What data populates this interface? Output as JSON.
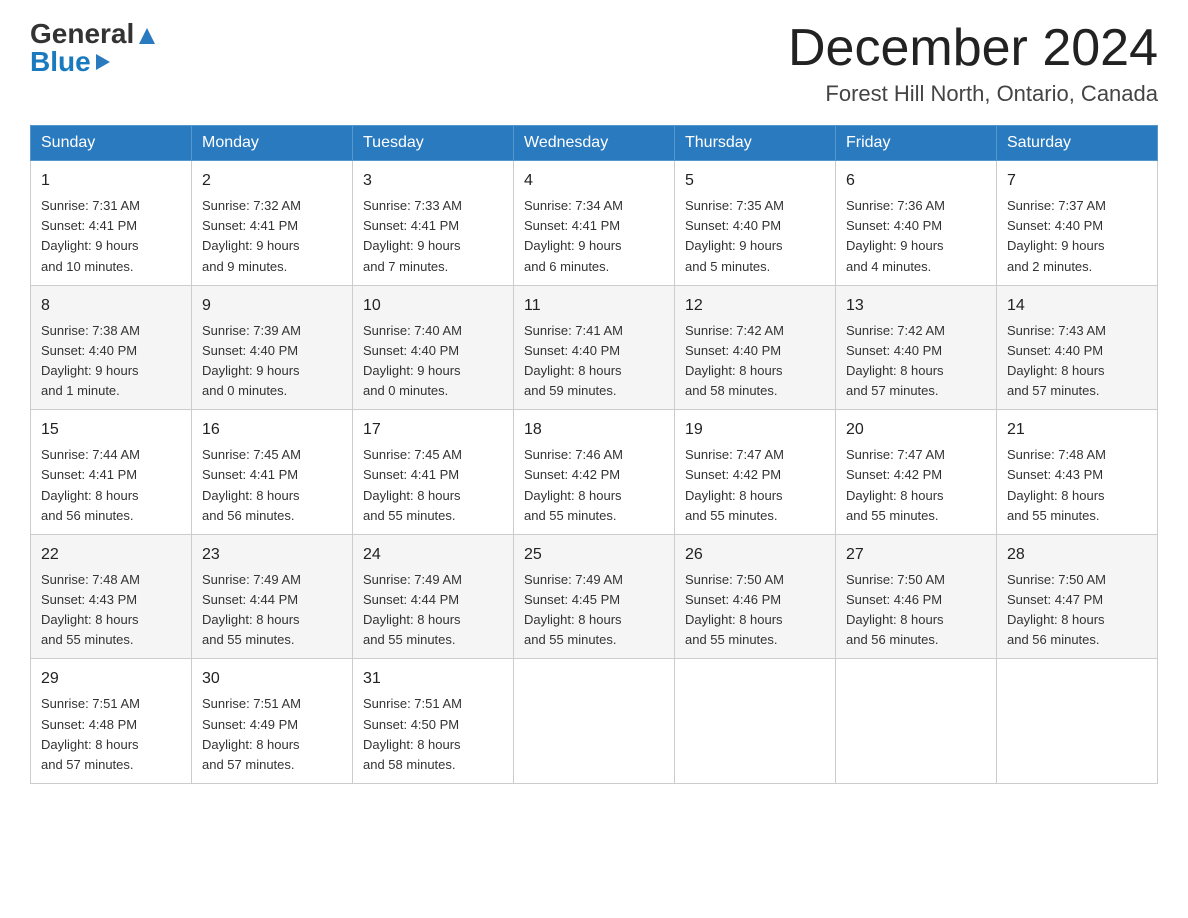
{
  "header": {
    "logo_general": "General",
    "logo_blue": "Blue",
    "month_title": "December 2024",
    "location": "Forest Hill North, Ontario, Canada"
  },
  "weekdays": [
    "Sunday",
    "Monday",
    "Tuesday",
    "Wednesday",
    "Thursday",
    "Friday",
    "Saturday"
  ],
  "weeks": [
    [
      {
        "day": "1",
        "sunrise": "7:31 AM",
        "sunset": "4:41 PM",
        "daylight": "9 hours and 10 minutes."
      },
      {
        "day": "2",
        "sunrise": "7:32 AM",
        "sunset": "4:41 PM",
        "daylight": "9 hours and 9 minutes."
      },
      {
        "day": "3",
        "sunrise": "7:33 AM",
        "sunset": "4:41 PM",
        "daylight": "9 hours and 7 minutes."
      },
      {
        "day": "4",
        "sunrise": "7:34 AM",
        "sunset": "4:41 PM",
        "daylight": "9 hours and 6 minutes."
      },
      {
        "day": "5",
        "sunrise": "7:35 AM",
        "sunset": "4:40 PM",
        "daylight": "9 hours and 5 minutes."
      },
      {
        "day": "6",
        "sunrise": "7:36 AM",
        "sunset": "4:40 PM",
        "daylight": "9 hours and 4 minutes."
      },
      {
        "day": "7",
        "sunrise": "7:37 AM",
        "sunset": "4:40 PM",
        "daylight": "9 hours and 2 minutes."
      }
    ],
    [
      {
        "day": "8",
        "sunrise": "7:38 AM",
        "sunset": "4:40 PM",
        "daylight": "9 hours and 1 minute."
      },
      {
        "day": "9",
        "sunrise": "7:39 AM",
        "sunset": "4:40 PM",
        "daylight": "9 hours and 0 minutes."
      },
      {
        "day": "10",
        "sunrise": "7:40 AM",
        "sunset": "4:40 PM",
        "daylight": "9 hours and 0 minutes."
      },
      {
        "day": "11",
        "sunrise": "7:41 AM",
        "sunset": "4:40 PM",
        "daylight": "8 hours and 59 minutes."
      },
      {
        "day": "12",
        "sunrise": "7:42 AM",
        "sunset": "4:40 PM",
        "daylight": "8 hours and 58 minutes."
      },
      {
        "day": "13",
        "sunrise": "7:42 AM",
        "sunset": "4:40 PM",
        "daylight": "8 hours and 57 minutes."
      },
      {
        "day": "14",
        "sunrise": "7:43 AM",
        "sunset": "4:40 PM",
        "daylight": "8 hours and 57 minutes."
      }
    ],
    [
      {
        "day": "15",
        "sunrise": "7:44 AM",
        "sunset": "4:41 PM",
        "daylight": "8 hours and 56 minutes."
      },
      {
        "day": "16",
        "sunrise": "7:45 AM",
        "sunset": "4:41 PM",
        "daylight": "8 hours and 56 minutes."
      },
      {
        "day": "17",
        "sunrise": "7:45 AM",
        "sunset": "4:41 PM",
        "daylight": "8 hours and 55 minutes."
      },
      {
        "day": "18",
        "sunrise": "7:46 AM",
        "sunset": "4:42 PM",
        "daylight": "8 hours and 55 minutes."
      },
      {
        "day": "19",
        "sunrise": "7:47 AM",
        "sunset": "4:42 PM",
        "daylight": "8 hours and 55 minutes."
      },
      {
        "day": "20",
        "sunrise": "7:47 AM",
        "sunset": "4:42 PM",
        "daylight": "8 hours and 55 minutes."
      },
      {
        "day": "21",
        "sunrise": "7:48 AM",
        "sunset": "4:43 PM",
        "daylight": "8 hours and 55 minutes."
      }
    ],
    [
      {
        "day": "22",
        "sunrise": "7:48 AM",
        "sunset": "4:43 PM",
        "daylight": "8 hours and 55 minutes."
      },
      {
        "day": "23",
        "sunrise": "7:49 AM",
        "sunset": "4:44 PM",
        "daylight": "8 hours and 55 minutes."
      },
      {
        "day": "24",
        "sunrise": "7:49 AM",
        "sunset": "4:44 PM",
        "daylight": "8 hours and 55 minutes."
      },
      {
        "day": "25",
        "sunrise": "7:49 AM",
        "sunset": "4:45 PM",
        "daylight": "8 hours and 55 minutes."
      },
      {
        "day": "26",
        "sunrise": "7:50 AM",
        "sunset": "4:46 PM",
        "daylight": "8 hours and 55 minutes."
      },
      {
        "day": "27",
        "sunrise": "7:50 AM",
        "sunset": "4:46 PM",
        "daylight": "8 hours and 56 minutes."
      },
      {
        "day": "28",
        "sunrise": "7:50 AM",
        "sunset": "4:47 PM",
        "daylight": "8 hours and 56 minutes."
      }
    ],
    [
      {
        "day": "29",
        "sunrise": "7:51 AM",
        "sunset": "4:48 PM",
        "daylight": "8 hours and 57 minutes."
      },
      {
        "day": "30",
        "sunrise": "7:51 AM",
        "sunset": "4:49 PM",
        "daylight": "8 hours and 57 minutes."
      },
      {
        "day": "31",
        "sunrise": "7:51 AM",
        "sunset": "4:50 PM",
        "daylight": "8 hours and 58 minutes."
      },
      null,
      null,
      null,
      null
    ]
  ],
  "labels": {
    "sunrise": "Sunrise:",
    "sunset": "Sunset:",
    "daylight": "Daylight:"
  }
}
